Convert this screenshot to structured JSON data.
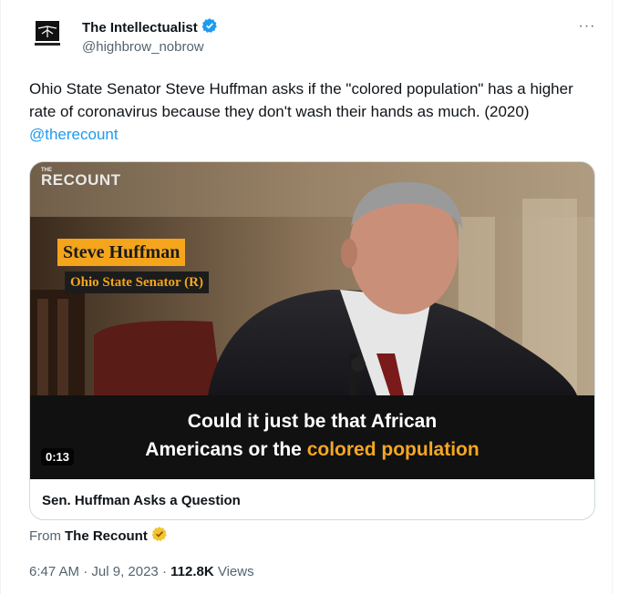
{
  "author": {
    "display_name": "The Intellectualist",
    "handle": "@highbrow_nobrow",
    "avatar_text": "The Intellectualist"
  },
  "tweet": {
    "text": "Ohio State Senator Steve Huffman asks if the \"colored population\" has a higher rate of coronavirus because they don't wash their hands as much. (2020) ",
    "mention": "@therecount"
  },
  "media": {
    "brand_small": "THE",
    "brand": "RECOUNT",
    "name_plate": "Steve Huffman",
    "title_plate": "Ohio State Senator (R)",
    "caption_line1": "Could it just be that African",
    "caption_line2_pre": "Americans or the ",
    "caption_line2_highlight": "colored population",
    "duration": "0:13",
    "title": "Sen. Huffman Asks a Question"
  },
  "source": {
    "from_label": "From",
    "name": "The Recount"
  },
  "meta": {
    "time": "6:47 AM",
    "separator": "·",
    "date": "Jul 9, 2023",
    "views_count": "112.8K",
    "views_label": "Views"
  },
  "colors": {
    "verified_blue": "#1d9bf0",
    "verified_gold": "#f4c430",
    "caption_highlight": "#f5a623"
  }
}
